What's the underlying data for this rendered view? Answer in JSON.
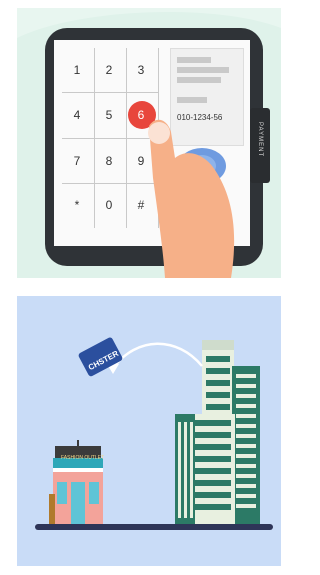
{
  "keypad": {
    "keys": [
      "1",
      "2",
      "3",
      "4",
      "5",
      "6",
      "7",
      "8",
      "9",
      "*",
      "0",
      "#"
    ]
  },
  "payment_screen": {
    "phone_number": "010-1234-56"
  },
  "card_reader": {
    "label": "PAYMENT"
  },
  "shop": {
    "sign": "FASHION OUTLET"
  },
  "card": {
    "brand": "CHSTER"
  },
  "colors": {
    "top_bg": "#e8f6f0",
    "bottom_bg": "#c9dcf7",
    "tablet_frame": "#2f3337",
    "button_red": "#e8463c",
    "hand": "#f6b088",
    "building_green": "#2c7a66",
    "building_light": "#e8f0e0",
    "card_blue": "#2b4f9e"
  }
}
